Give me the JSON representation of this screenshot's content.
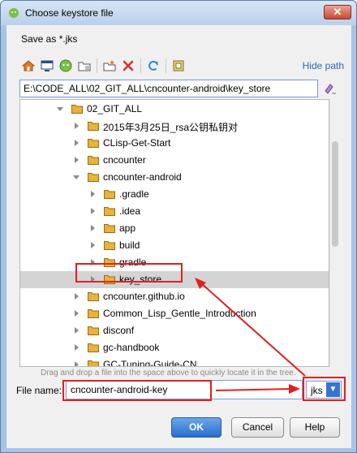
{
  "window": {
    "title": "Choose keystore file",
    "close_label": "✕"
  },
  "dialog": {
    "save_as": "Save as *.jks",
    "hide_path": "Hide path",
    "path_value": "E:\\CODE_ALL\\02_GIT_ALL\\cncounter-android\\key_store",
    "drag_hint": "Drag and drop a file into the space above to quickly locate it in the tree.",
    "file_name_label": "File name:",
    "file_name_value": "cncounter-android-key",
    "extension_value": "jks",
    "ok_label": "OK",
    "cancel_label": "Cancel",
    "help_label": "Help"
  },
  "toolbar": {
    "icons": [
      "home-icon",
      "desktop-icon",
      "android-module-icon",
      "new-folder-icon",
      "delete-icon",
      "refresh-icon",
      "show-hidden-icon"
    ]
  },
  "tree": {
    "nodes": [
      {
        "label": "02_GIT_ALL",
        "level": 0,
        "expanded": true
      },
      {
        "label": "2015年3月25日_rsa公钥私钥对",
        "level": 1,
        "expanded": false
      },
      {
        "label": "CLisp-Get-Start",
        "level": 1,
        "expanded": false
      },
      {
        "label": "cncounter",
        "level": 1,
        "expanded": false
      },
      {
        "label": "cncounter-android",
        "level": 1,
        "expanded": true
      },
      {
        "label": ".gradle",
        "level": 2,
        "expanded": false
      },
      {
        "label": ".idea",
        "level": 2,
        "expanded": false
      },
      {
        "label": "app",
        "level": 2,
        "expanded": false
      },
      {
        "label": "build",
        "level": 2,
        "expanded": false
      },
      {
        "label": "gradle",
        "level": 2,
        "expanded": false
      },
      {
        "label": "key_store",
        "level": 2,
        "expanded": false,
        "selected": true
      },
      {
        "label": "cncounter.github.io",
        "level": 1,
        "expanded": false
      },
      {
        "label": "Common_Lisp_Gentle_Introduction",
        "level": 1,
        "expanded": false
      },
      {
        "label": "disconf",
        "level": 1,
        "expanded": false
      },
      {
        "label": "gc-handbook",
        "level": 1,
        "expanded": false
      },
      {
        "label": "GC-Tuning-Guide-CN",
        "level": 1,
        "expanded": false
      }
    ]
  },
  "colors": {
    "accent": "#2a6dcc",
    "annotation": "#e02020",
    "folder": "#e8b33a",
    "selection": "#d4d4d4"
  }
}
